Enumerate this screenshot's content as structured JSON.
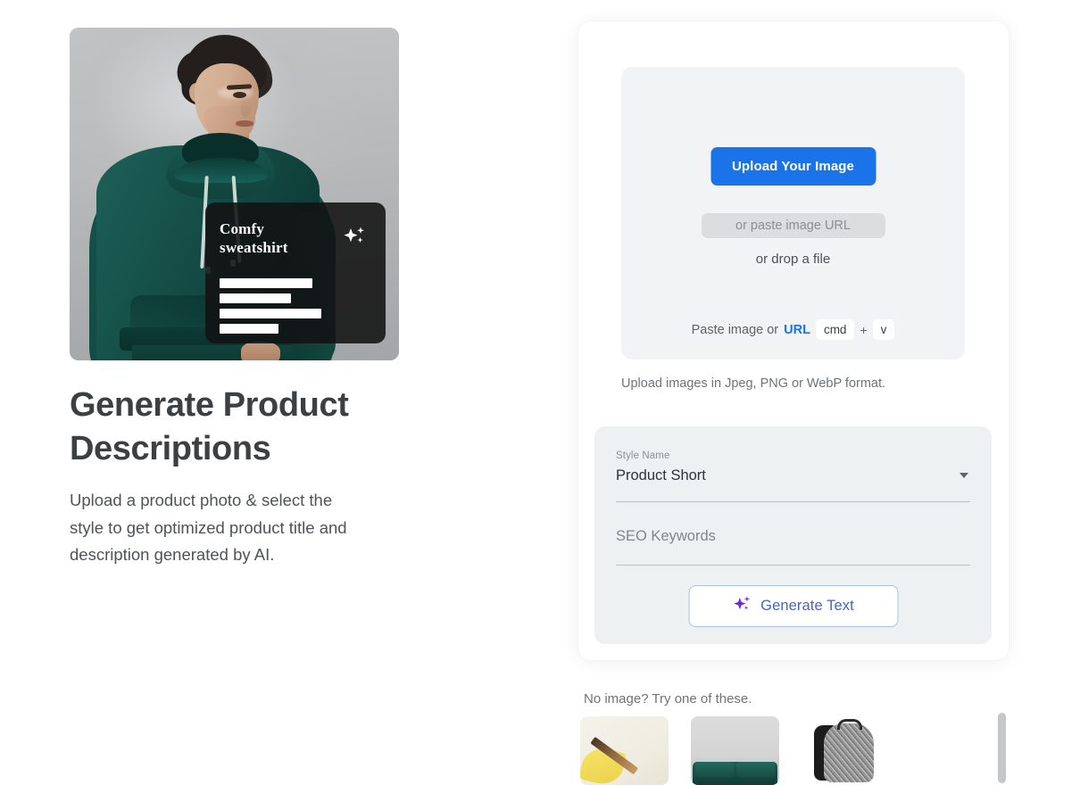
{
  "hero": {
    "card": {
      "title_line1": "Comfy",
      "title_line2": "sweatshirt",
      "sparkle_icon": "sparkle-icon"
    },
    "title": "Generate Product Descriptions",
    "subtitle": "Upload a product photo & select the style to get optimized product title and description generated by AI."
  },
  "upload": {
    "button_label": "Upload Your Image",
    "url_placeholder": "or paste image URL",
    "url_value": "",
    "drop_text": "or drop a file",
    "paste_prefix": "Paste image or",
    "paste_link": "URL",
    "kbd_cmd": "cmd",
    "kbd_plus": "+",
    "kbd_key": "v",
    "format_note": "Upload images in Jpeg, PNG or WebP format."
  },
  "form": {
    "style": {
      "label": "Style Name",
      "value": "Product Short",
      "caret_icon": "chevron-down-icon"
    },
    "keywords": {
      "placeholder": "SEO Keywords",
      "value": ""
    },
    "generate": {
      "label": "Generate Text",
      "icon": "sparkle-icon"
    }
  },
  "suggestions": {
    "title": "No image? Try one of these.",
    "items": [
      {
        "name": "banana-pencil-thumbnail"
      },
      {
        "name": "green-sofa-thumbnail"
      },
      {
        "name": "grey-backpack-thumbnail"
      }
    ]
  },
  "colors": {
    "primary_blue": "#1a73e8",
    "link_blue": "#1a73e8",
    "generate_text": "#4864c4",
    "sparkle_purple": "#7c3aed",
    "panel_grey": "#f1f3f4",
    "form_panel_grey": "#eef1f2",
    "text_dark": "#3c4043",
    "text_muted": "#6f7478"
  }
}
